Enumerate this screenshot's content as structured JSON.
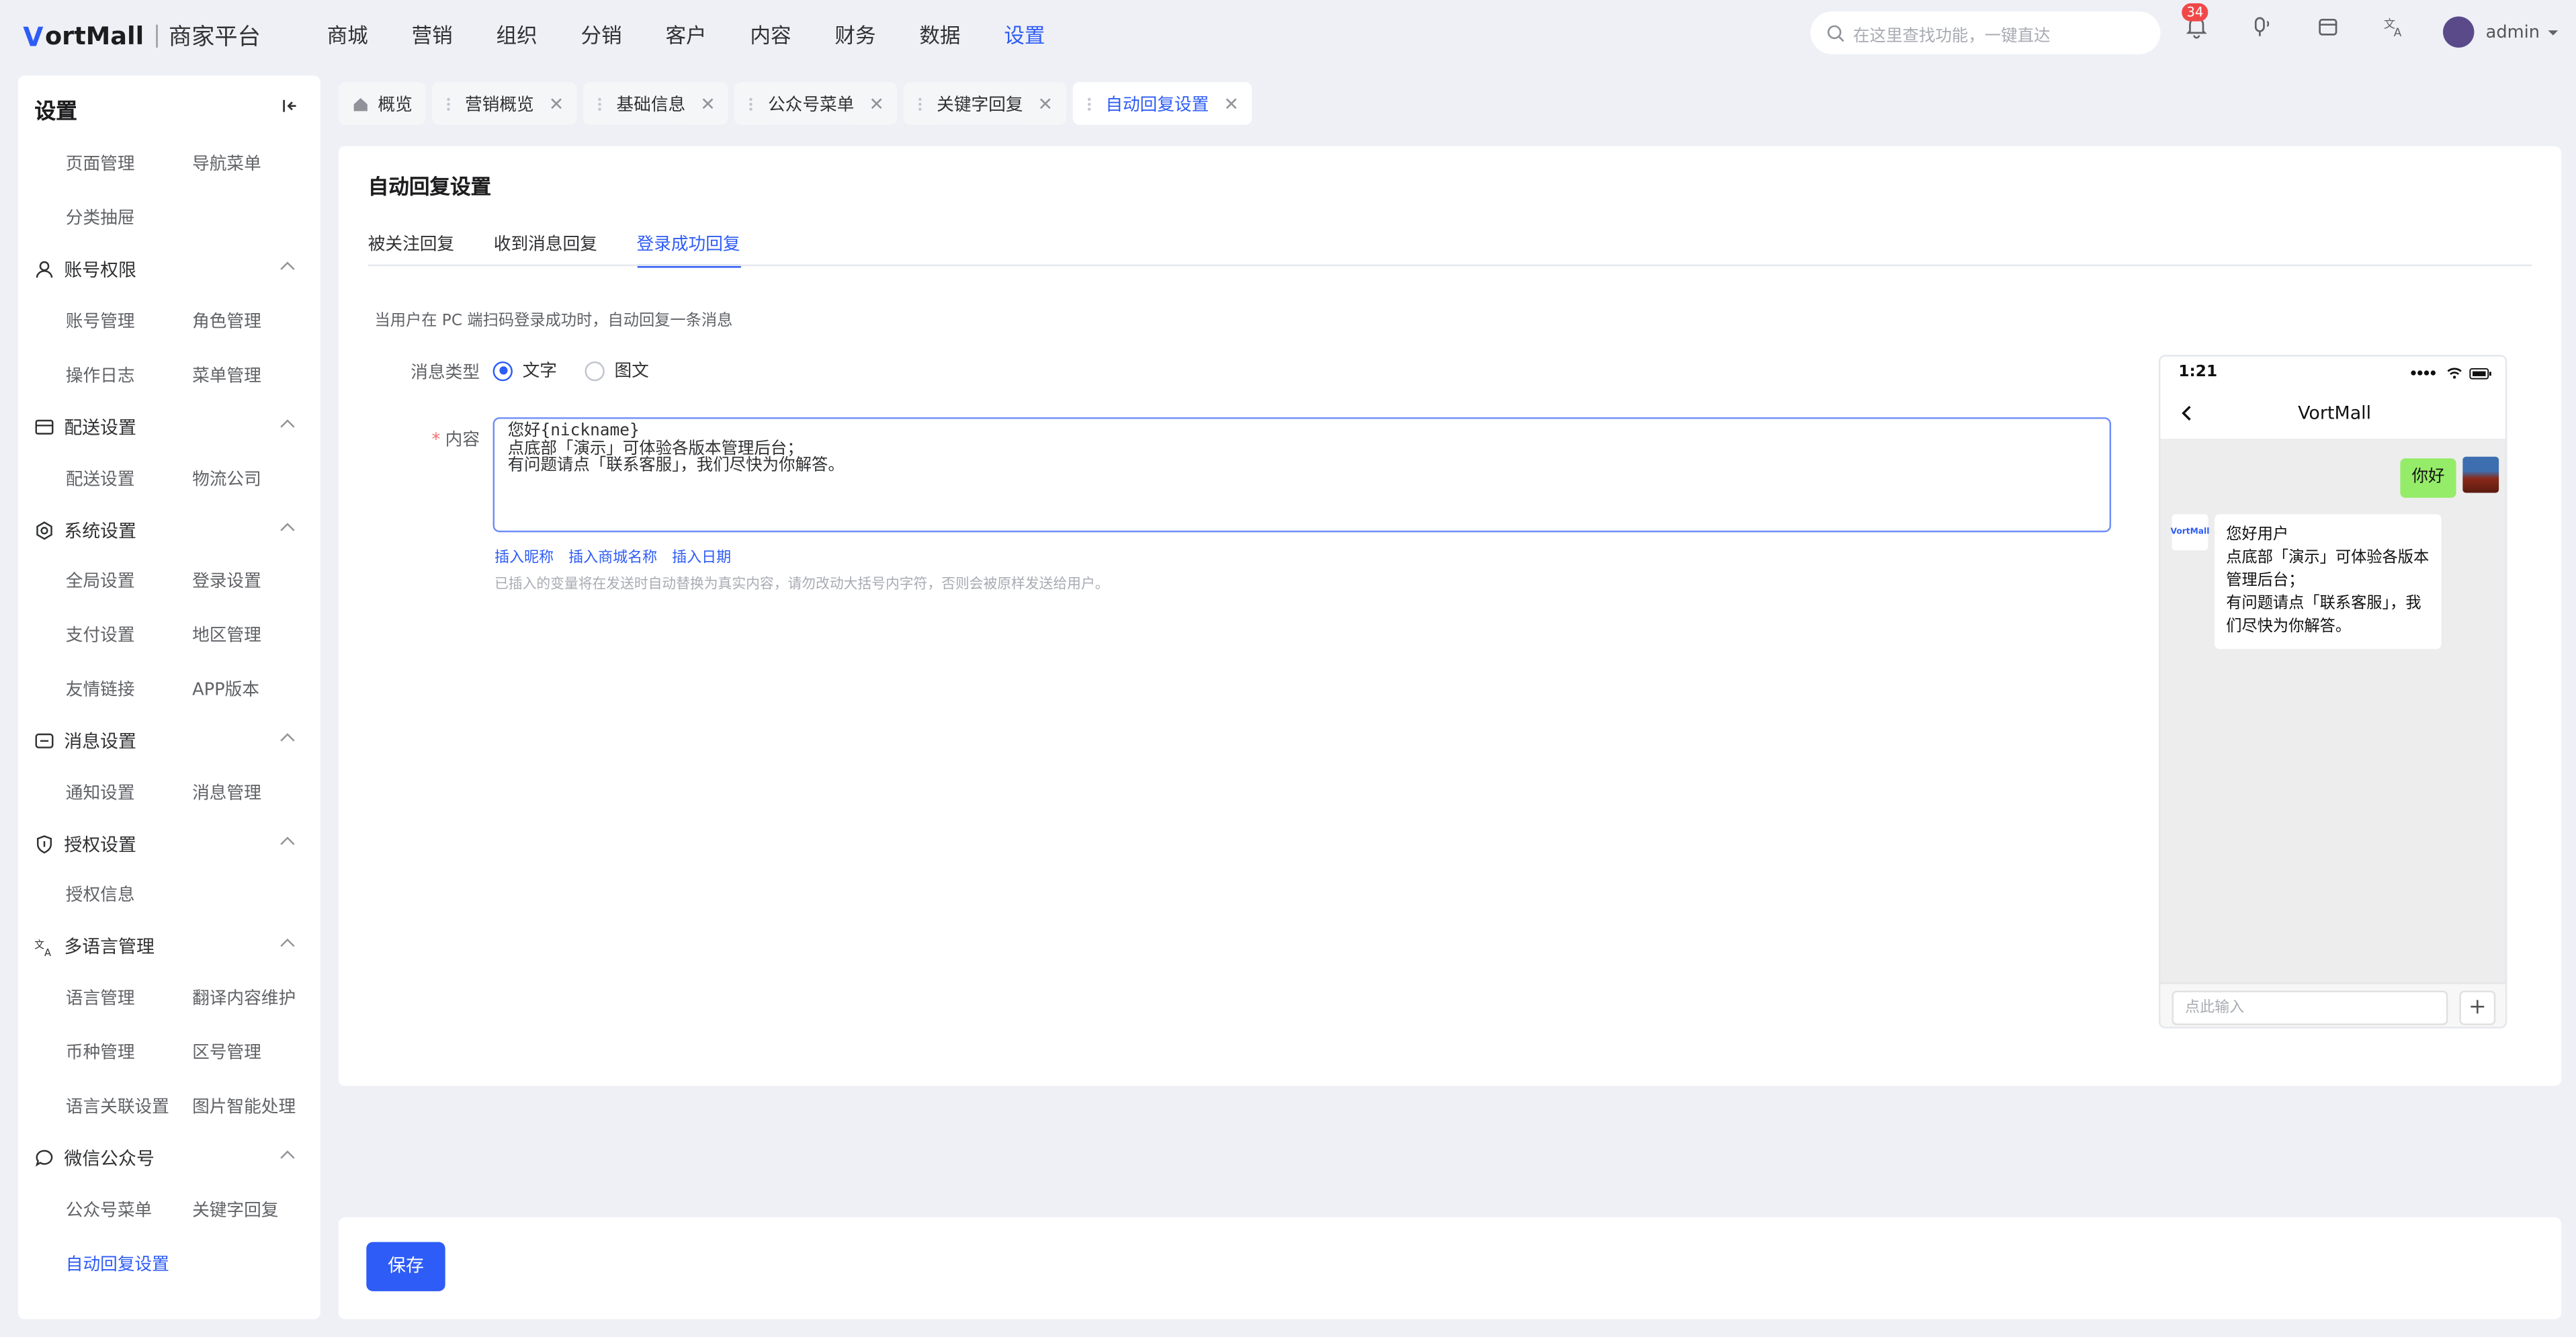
{
  "brand": {
    "logo_mark": "V",
    "logo_text": "ortMall",
    "platform": "商家平台"
  },
  "nav": [
    "商城",
    "营销",
    "组织",
    "分销",
    "客户",
    "内容",
    "财务",
    "数据",
    "设置"
  ],
  "search": {
    "placeholder": "在这里查找功能，一键直达"
  },
  "notifications": {
    "count": "34"
  },
  "user": {
    "name": "admin"
  },
  "sidebar": {
    "title": "设置",
    "items_top": [
      "页面管理",
      "导航菜单",
      "分类抽屉"
    ],
    "groups": [
      {
        "label": "账号权限",
        "icon": "user-icon",
        "items": [
          "账号管理",
          "角色管理",
          "操作日志",
          "菜单管理"
        ]
      },
      {
        "label": "配送设置",
        "icon": "truck-icon",
        "items": [
          "配送设置",
          "物流公司"
        ]
      },
      {
        "label": "系统设置",
        "icon": "gear-icon",
        "items": [
          "全局设置",
          "登录设置",
          "支付设置",
          "地区管理",
          "友情链接",
          "APP版本"
        ]
      },
      {
        "label": "消息设置",
        "icon": "message-icon",
        "items": [
          "通知设置",
          "消息管理"
        ]
      },
      {
        "label": "授权设置",
        "icon": "shield-icon",
        "items": [
          "授权信息"
        ]
      },
      {
        "label": "多语言管理",
        "icon": "translate-icon",
        "items": [
          "语言管理",
          "翻译内容维护",
          "币种管理",
          "区号管理",
          "语言关联设置",
          "图片智能处理"
        ]
      },
      {
        "label": "微信公众号",
        "icon": "wechat-icon",
        "items": [
          "公众号菜单",
          "关键字回复",
          "自动回复设置"
        ]
      }
    ]
  },
  "tabs": [
    "概览",
    "营销概览",
    "基础信息",
    "公众号菜单",
    "关键字回复",
    "自动回复设置"
  ],
  "page": {
    "title": "自动回复设置",
    "subtabs": [
      "被关注回复",
      "收到消息回复",
      "登录成功回复"
    ],
    "description": "当用户在 PC 端扫码登录成功时，自动回复一条消息",
    "msg_type_label": "消息类型",
    "msg_types": [
      "文字",
      "图文"
    ],
    "selected_type": "文字",
    "content_label": "内容",
    "content_value": "您好{nickname}\n点底部「演示」可体验各版本管理后台；\n有问题请点「联系客服」，我们尽快为你解答。",
    "insert_links": [
      "插入昵称",
      "插入商城名称",
      "插入日期"
    ],
    "hint": "已插入的变量将在发送时自动替换为真实内容，请勿改动大括号内字符，否则会被原样发送给用户。"
  },
  "preview": {
    "time": "1:21",
    "chat_title": "VortMall",
    "user_message": "你好",
    "bot_avatar_text": "VortMall",
    "bot_reply": "您好用户\n点底部「演示」可体验各版本管理后台；\n有问题请点「联系客服」，我们尽快为你解答。",
    "input_placeholder": "点此输入",
    "plus": "+"
  },
  "footer": {
    "save_label": "保存"
  },
  "colors": {
    "accent": "#2e5cf6",
    "user_bubble": "#95ec69",
    "badge": "#f04848"
  }
}
